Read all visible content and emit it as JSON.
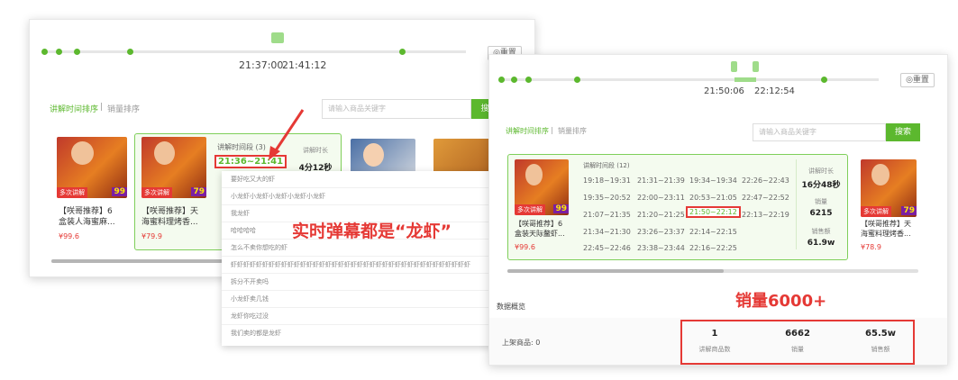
{
  "left_panel": {
    "timeline": {
      "time_start": "21:37:00",
      "time_end": "21:41:12",
      "reset_button": "◎重置"
    },
    "tabs": {
      "active": "讲解时间排序",
      "inactive": "销量排序"
    },
    "search": {
      "placeholder": "请输入商品关键字",
      "button": "搜"
    },
    "products": [
      {
        "name_line1": "【咲哥推荐】6",
        "name_line2": "盒装人海蜜麻...",
        "price": "¥99.6",
        "badge": "多次讲解",
        "price_badge": "99"
      },
      {
        "name_line1": "【咲哥推荐】天",
        "name_line2": "海蜜料理烤香...",
        "price": "¥79.9",
        "badge": "多次讲解",
        "price_badge": "79"
      }
    ],
    "explain_time_label": "讲解时间段 (3)",
    "explain_slot": "21:36~21:41",
    "duration_label": "讲解时长",
    "duration_value": "4分12秒"
  },
  "danmu": {
    "rows": [
      "要好吃又大的虾",
      "小龙虾小龙虾小龙虾小龙虾小龙虾",
      "我龙虾",
      "哈哈哈哈",
      "怎么不卖你想吃的虾",
      "虾虾虾虾虾虾虾虾虾虾虾虾虾虾虾虾虾虾虾虾虾虾虾虾虾虾虾虾虾虾虾虾虾虾虾虾虾虾",
      "拆分不开卖吗",
      "小龙虾卖几钱",
      "龙虾你吃过没",
      "我们卖的都是龙虾"
    ],
    "annotation": "实时弹幕都是“龙虾”"
  },
  "right_panel": {
    "timeline": {
      "time_start": "21:50:06",
      "time_end": "22:12:54",
      "reset_button": "◎重置"
    },
    "tabs": {
      "active": "讲解时间排序",
      "inactive": "销量排序"
    },
    "search": {
      "placeholder": "请输入商品关键字",
      "button": "搜索"
    },
    "explain_label": "讲解时间段 (12)",
    "slots": [
      "19:18~19:31",
      "21:31~21:39",
      "19:34~19:34",
      "22:26~22:43",
      "19:35~20:52",
      "22:00~23:11",
      "20:53~21:05",
      "22:47~22:52",
      "21:07~21:35",
      "21:20~21:25",
      "21:50~22:12",
      "22:13~22:19",
      "21:34~21:30",
      "23:26~23:37",
      "22:14~22:15",
      "22:45~22:46",
      "23:38~23:44",
      "22:16~22:25"
    ],
    "stats": [
      {
        "label": "讲解时长",
        "value": "16分48秒"
      },
      {
        "label": "销量",
        "value": "6215"
      },
      {
        "label": "销售额",
        "value": "61.9w"
      }
    ],
    "products": [
      {
        "name_line1": "【咲哥推荐】6",
        "name_line2": "盒装天际鳌虾...",
        "price": "¥99.6",
        "badge": "多次讲解",
        "price_badge": "99"
      },
      {
        "name_line1": "【咲哥推荐】天",
        "name_line2": "海蜜料理烤香...",
        "price": "¥78.9",
        "badge": "多次讲解",
        "price_badge": "79"
      }
    ],
    "sales_annotation": "销量6000+",
    "section_title": "数据概览",
    "listed_label": "上架商品: 0",
    "summary": [
      {
        "value": "1",
        "label": "讲解商品数"
      },
      {
        "value": "6662",
        "label": "销量"
      },
      {
        "value": "65.5w",
        "label": "销售额"
      }
    ]
  },
  "colors": {
    "accent_green": "#5cb82e",
    "annotation_red": "#e53935"
  }
}
